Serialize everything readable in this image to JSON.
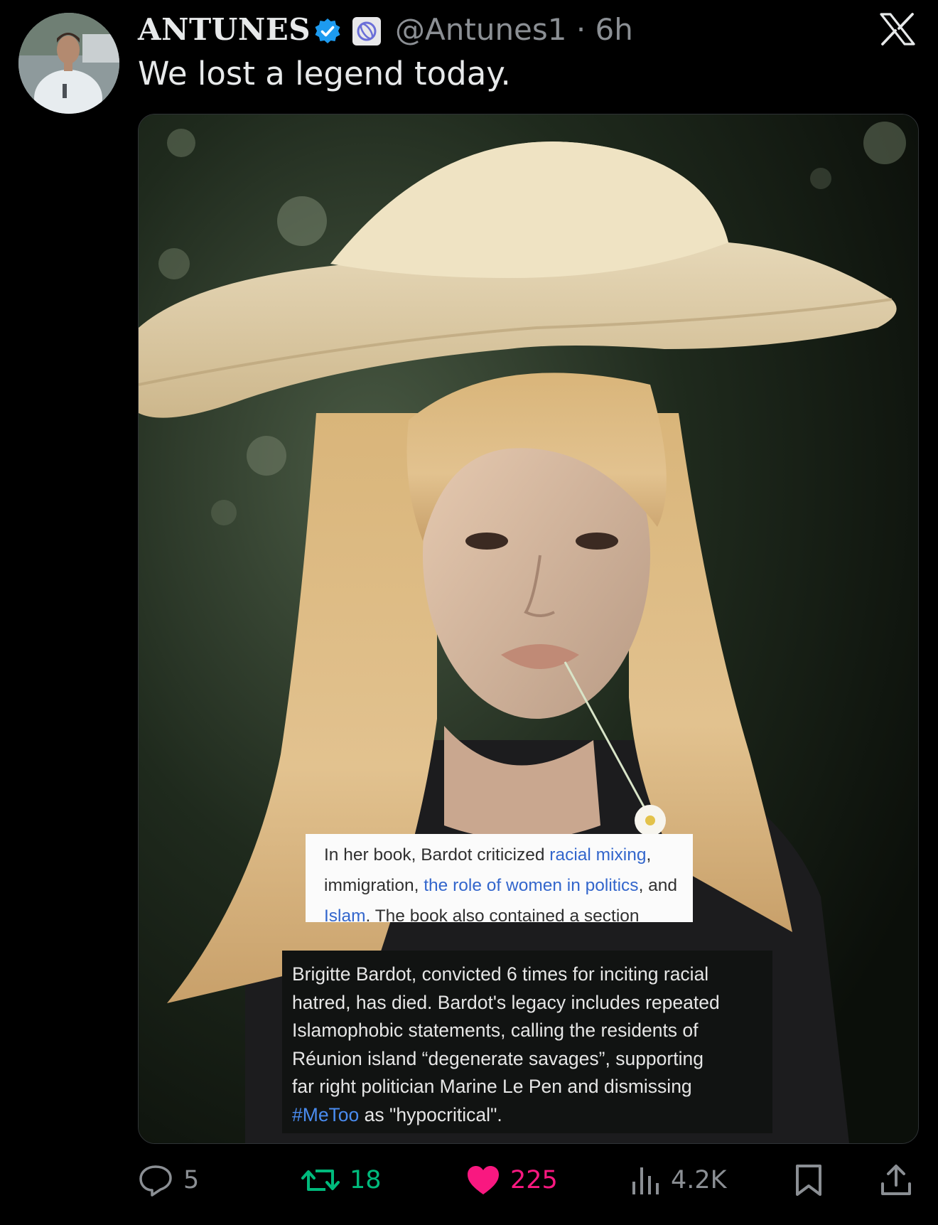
{
  "author": {
    "display_name": "ANTUNES",
    "handle_time": "@Antunes1 · 6h"
  },
  "tweet": {
    "text": "We lost a legend today."
  },
  "media": {
    "caption_white": {
      "part1": "In her book, Bardot criticized ",
      "link1": "racial mixing",
      "part2": ",",
      "part3": "immigration, ",
      "link2": "the role of women in politics",
      "part4": ", and",
      "link3": "Islam",
      "part5": ". The book also contained a section"
    },
    "caption_dark": {
      "line1": "Brigitte Bardot, convicted 6 times for inciting racial",
      "line2": "hatred, has died. Bardot's legacy includes repeated",
      "line3": "Islamophobic statements, calling the residents of",
      "line4": "Réunion island “degenerate savages”, supporting",
      "line5": "far right politician Marine Le Pen and dismissing",
      "hashtag": "#MeToo",
      "line6_rest": " as \"hypocritical\"."
    }
  },
  "actions": {
    "replies": "5",
    "retweets": "18",
    "likes": "225",
    "views": "4.2K"
  },
  "colors": {
    "background": "#000000",
    "verified": "#1d9bf0",
    "retweet": "#00ba7c",
    "like": "#f91880",
    "muted": "#8b8f94"
  },
  "icons": [
    "x-logo-icon",
    "verified-badge-icon",
    "affiliate-badge-icon",
    "reply-icon",
    "retweet-icon",
    "heart-icon",
    "views-icon",
    "bookmark-icon",
    "share-icon"
  ]
}
